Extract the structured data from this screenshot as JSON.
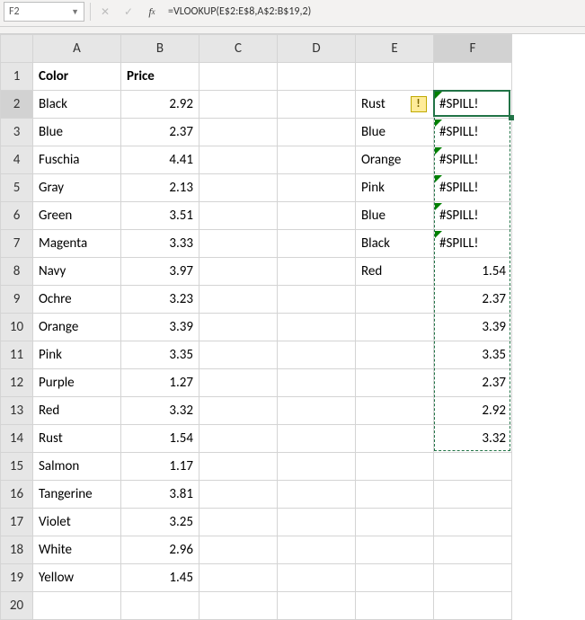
{
  "formula_bar": {
    "name_box": "F2",
    "formula": "=VLOOKUP(E$2:E$8,A$2:B$19,2)"
  },
  "columns": [
    "A",
    "B",
    "C",
    "D",
    "E",
    "F"
  ],
  "header_row": {
    "A": "Color",
    "B": "Price"
  },
  "tableA": [
    {
      "color": "Black",
      "price": "2.92"
    },
    {
      "color": "Blue",
      "price": "2.37"
    },
    {
      "color": "Fuschia",
      "price": "4.41"
    },
    {
      "color": "Gray",
      "price": "2.13"
    },
    {
      "color": "Green",
      "price": "3.51"
    },
    {
      "color": "Magenta",
      "price": "3.33"
    },
    {
      "color": "Navy",
      "price": "3.97"
    },
    {
      "color": "Ochre",
      "price": "3.23"
    },
    {
      "color": "Orange",
      "price": "3.39"
    },
    {
      "color": "Pink",
      "price": "3.35"
    },
    {
      "color": "Purple",
      "price": "1.27"
    },
    {
      "color": "Red",
      "price": "3.32"
    },
    {
      "color": "Rust",
      "price": "1.54"
    },
    {
      "color": "Salmon",
      "price": "1.17"
    },
    {
      "color": "Tangerine",
      "price": "3.81"
    },
    {
      "color": "Violet",
      "price": "3.25"
    },
    {
      "color": "White",
      "price": "2.96"
    },
    {
      "color": "Yellow",
      "price": "1.45"
    }
  ],
  "colE": [
    "Rust",
    "Blue",
    "Orange",
    "Pink",
    "Blue",
    "Black",
    "Red"
  ],
  "colF": [
    "#SPILL!",
    "#SPILL!",
    "#SPILL!",
    "#SPILL!",
    "#SPILL!",
    "#SPILL!",
    "1.54",
    "2.37",
    "3.39",
    "3.35",
    "2.37",
    "2.92",
    "3.32"
  ],
  "spill_error_label": "#SPILL!",
  "chart_data": {
    "type": "table",
    "title": "",
    "columns": [
      "Color",
      "Price"
    ],
    "rows": [
      [
        "Black",
        2.92
      ],
      [
        "Blue",
        2.37
      ],
      [
        "Fuschia",
        4.41
      ],
      [
        "Gray",
        2.13
      ],
      [
        "Green",
        3.51
      ],
      [
        "Magenta",
        3.33
      ],
      [
        "Navy",
        3.97
      ],
      [
        "Ochre",
        3.23
      ],
      [
        "Orange",
        3.39
      ],
      [
        "Pink",
        3.35
      ],
      [
        "Purple",
        1.27
      ],
      [
        "Red",
        3.32
      ],
      [
        "Rust",
        1.54
      ],
      [
        "Salmon",
        1.17
      ],
      [
        "Tangerine",
        3.81
      ],
      [
        "Violet",
        3.25
      ],
      [
        "White",
        2.96
      ],
      [
        "Yellow",
        1.45
      ]
    ],
    "lookup_input": [
      "Rust",
      "Blue",
      "Orange",
      "Pink",
      "Blue",
      "Black",
      "Red"
    ],
    "lookup_output": [
      "#SPILL!",
      "#SPILL!",
      "#SPILL!",
      "#SPILL!",
      "#SPILL!",
      "#SPILL!",
      1.54,
      2.37,
      3.39,
      3.35,
      2.37,
      2.92,
      3.32
    ]
  }
}
